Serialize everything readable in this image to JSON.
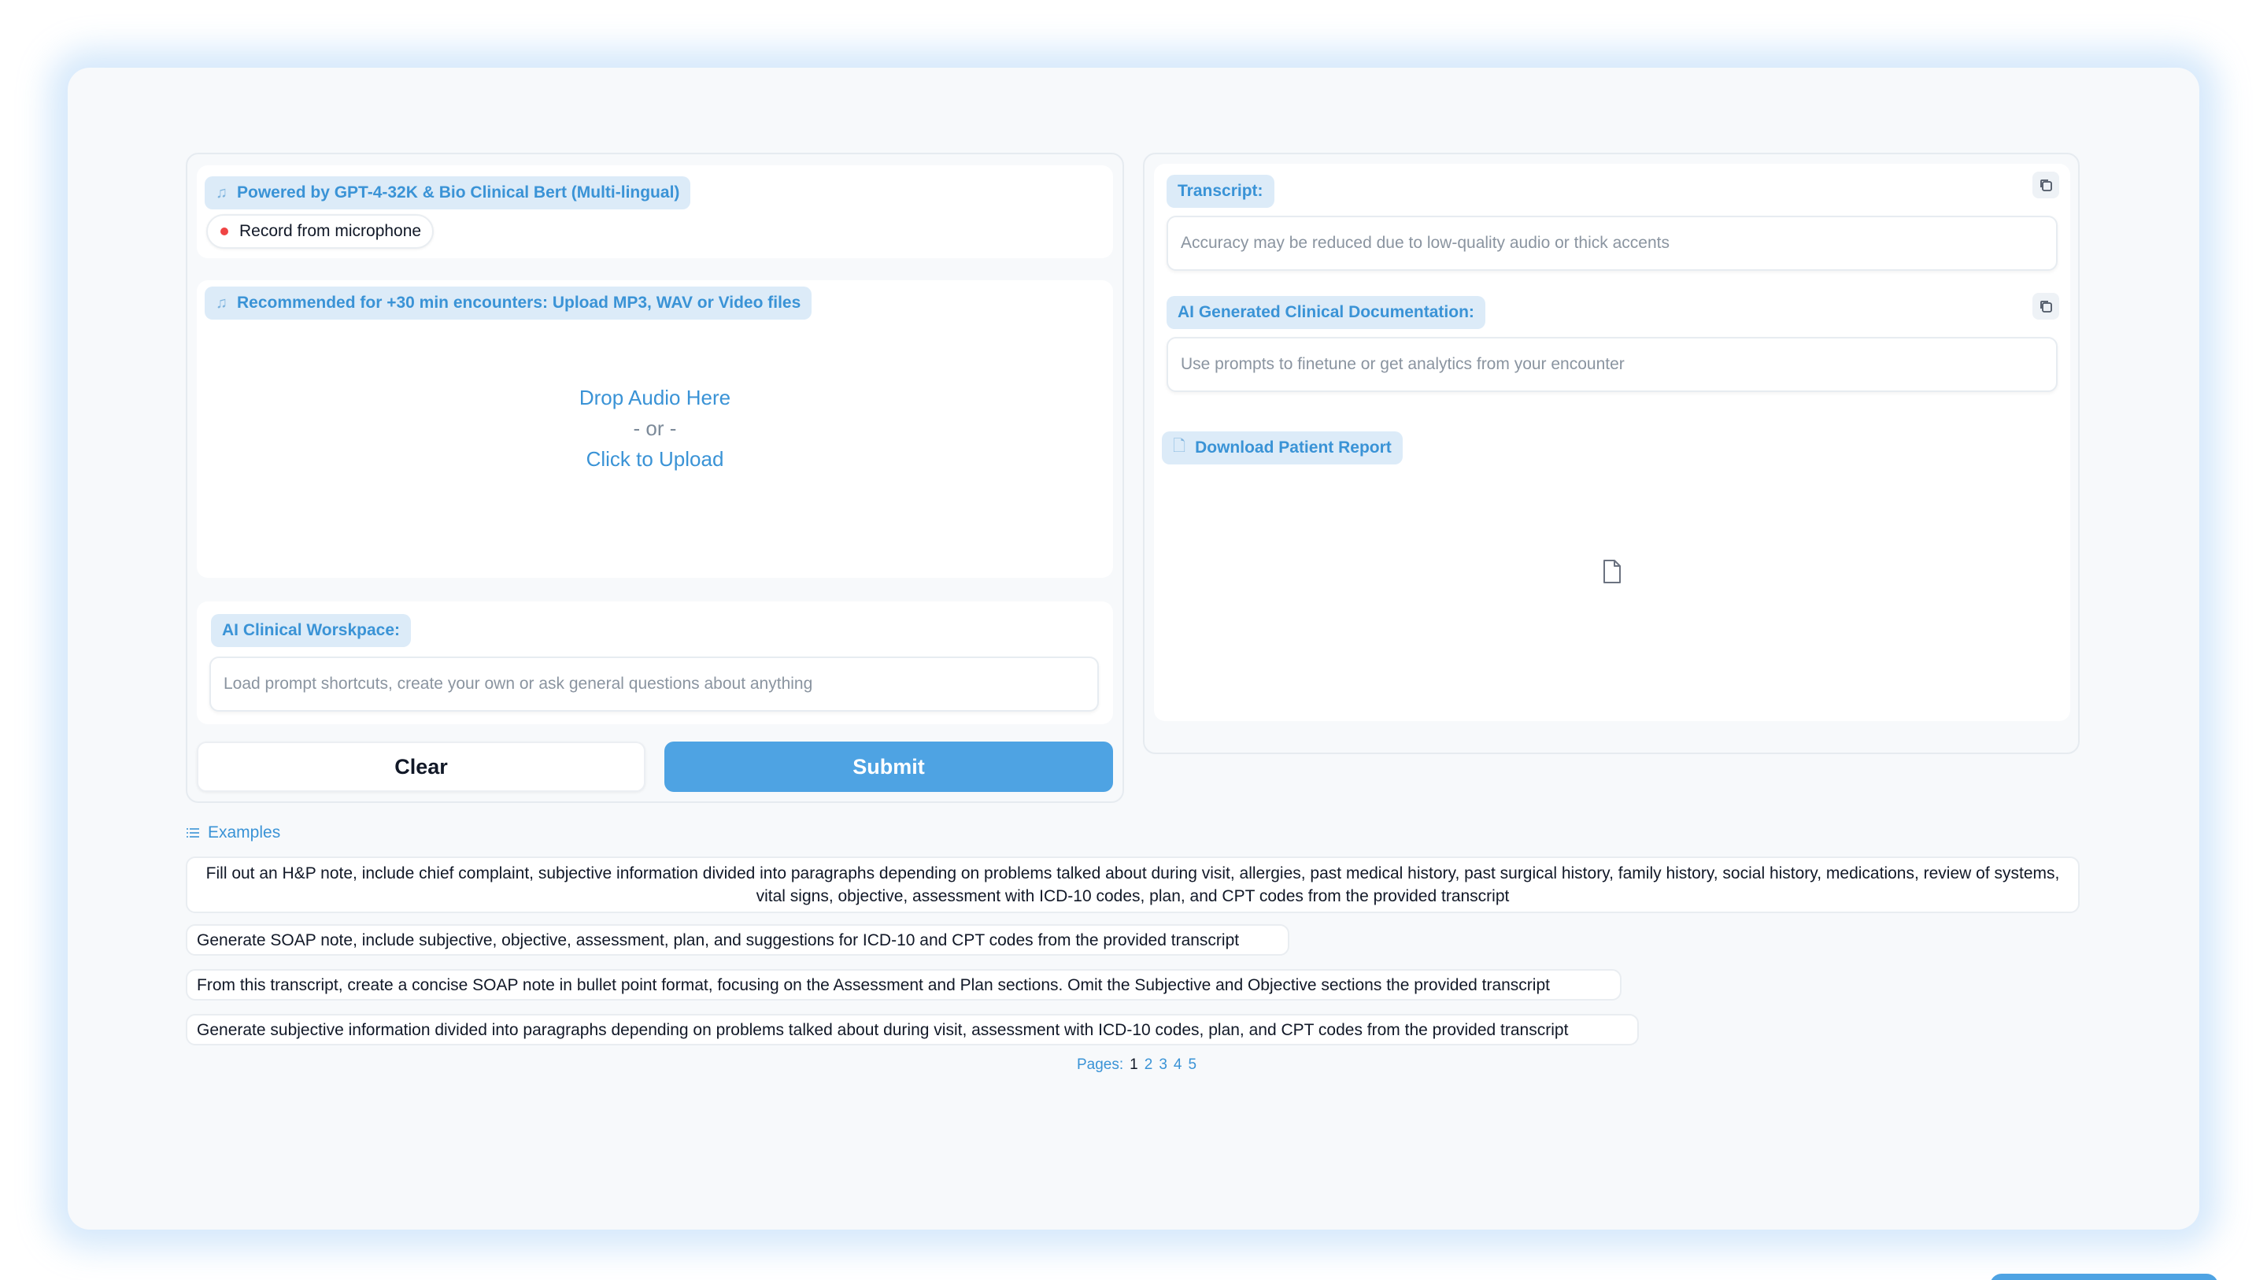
{
  "input_panel": {
    "mic_section": {
      "label": "Powered by GPT-4-32K & Bio Clinical Bert (Multi-lingual)",
      "label_icon": "music-note-icon",
      "record_label": "Record from microphone"
    },
    "upload_section": {
      "label": "Recommended for +30 min encounters: Upload MP3, WAV or Video files",
      "label_icon": "music-note-icon",
      "drop_text": "Drop Audio Here",
      "or_text": "- or -",
      "click_text": "Click to Upload"
    },
    "workspace": {
      "label": "AI Clinical Worskpace:",
      "placeholder": "Load prompt shortcuts, create your own or ask general questions about anything"
    },
    "clear_label": "Clear",
    "submit_label": "Submit"
  },
  "output_panel": {
    "transcript": {
      "label": "Transcript:",
      "placeholder": "Accuracy may be reduced due to low-quality audio or thick accents"
    },
    "documentation": {
      "label": "AI Generated Clinical Documentation:",
      "placeholder": "Use prompts to finetune or get analytics from your encounter"
    },
    "report": {
      "label": "Download Patient Report",
      "icon": "file-icon"
    }
  },
  "examples": {
    "title": "Examples",
    "title_icon": "list-icon",
    "items": [
      "Fill out an H&P note, include chief complaint, subjective information divided into paragraphs depending on problems talked about during visit, allergies, past medical history, past surgical history, family history, social history, medications, review of systems, vital signs, objective, assessment with ICD-10 codes, plan, and CPT codes from the provided transcript",
      "Generate SOAP note, include subjective, objective, assessment, plan, and suggestions for ICD-10 and CPT codes from the provided transcript",
      "From this transcript, create a concise SOAP note in bullet point format, focusing on the Assessment and Plan sections. Omit the Subjective and Objective sections the provided transcript",
      "Generate subjective information divided into paragraphs depending on problems talked about during visit, assessment with ICD-10 codes, plan, and CPT codes from the provided transcript"
    ],
    "pages_label": "Pages:",
    "pages": [
      "1",
      "2",
      "3",
      "4",
      "5"
    ]
  },
  "colors": {
    "accent": "#3a93d6",
    "submit_bg": "#4ea3e3",
    "chip_bg": "#dcebf8",
    "record_dot": "#ef4444"
  }
}
